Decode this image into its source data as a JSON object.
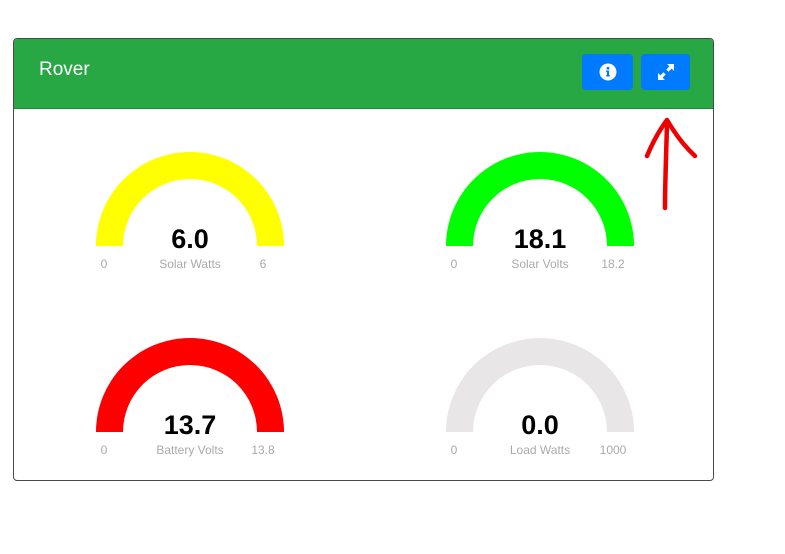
{
  "card": {
    "title": "Rover",
    "info_button": {
      "icon": "info-circle-icon"
    },
    "expand_button": {
      "icon": "expand-icon"
    }
  },
  "gauges": [
    {
      "label": "Solar Watts",
      "value": "6.0",
      "min": "0",
      "max": "6",
      "color": "#ffff00",
      "fill": 1.0
    },
    {
      "label": "Solar Volts",
      "value": "18.1",
      "min": "0",
      "max": "18.2",
      "color": "#00ff00",
      "fill": 1.0
    },
    {
      "label": "Battery Volts",
      "value": "13.7",
      "min": "0",
      "max": "13.8",
      "color": "#ff0000",
      "fill": 1.0
    },
    {
      "label": "Load Watts",
      "value": "0.0",
      "min": "0",
      "max": "1000",
      "color": "#ff0000",
      "fill": 0.0
    }
  ],
  "colors": {
    "header": "#28a745",
    "button": "#007bff",
    "gauge_track": "#e8e6e6",
    "annotation": "#ee0000"
  },
  "annotation": {
    "type": "red-hand-drawn-arrow",
    "points_to": "expand-button"
  }
}
